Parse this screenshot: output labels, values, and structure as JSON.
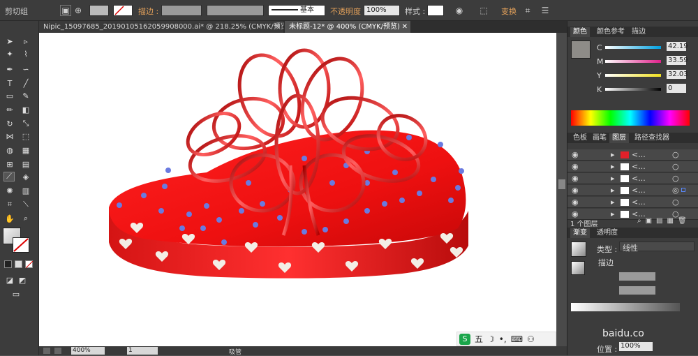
{
  "control_bar": {
    "group_label": "剪切组",
    "stroke_label": "描边 :",
    "stroke_style": "基本",
    "opacity_label": "不透明度 :",
    "opacity_value": "100%",
    "style_label": "样式 :",
    "transform_label": "变换"
  },
  "tabs": [
    {
      "label": "Nipic_15097685_20190105162059908000.ai* @ 218.25% (CMYK/预览)",
      "close": "✕"
    },
    {
      "label": "未标题-12* @ 400% (CMYK/预览)",
      "close": "✕"
    }
  ],
  "status": {
    "zoom": "400%",
    "page": "1",
    "tool": "吸管"
  },
  "color_panel": {
    "tabs": [
      "颜色",
      "颜色参考",
      "描边"
    ],
    "channels": [
      {
        "name": "C",
        "value": "42.19"
      },
      {
        "name": "M",
        "value": "33.59"
      },
      {
        "name": "Y",
        "value": "32.03"
      },
      {
        "name": "K",
        "value": "0"
      }
    ],
    "fill_color": "#8e8c88"
  },
  "layers_panel": {
    "tabs": [
      "色板",
      "画笔",
      "图层",
      "路径查找器"
    ],
    "rows": [
      {
        "name": "<...",
        "swatch": "#e0202a"
      },
      {
        "name": "<...",
        "swatch": "#ffffff"
      },
      {
        "name": "<...",
        "swatch": "#ffffff"
      },
      {
        "name": "<...",
        "swatch": "#ffffff"
      },
      {
        "name": "<...",
        "swatch": "#ffffff"
      },
      {
        "name": "<...",
        "swatch": "#ffffff"
      }
    ],
    "footer": "1 个图层"
  },
  "gradient_panel": {
    "tabs": [
      "渐变",
      "透明度"
    ],
    "type_label": "类型 :",
    "type_value": "线性",
    "stroke_label": "描边",
    "position_label": "位置 :",
    "position_value": "100%"
  },
  "ime_bar": {
    "brand": "五",
    "watermark": "baidu.co"
  }
}
